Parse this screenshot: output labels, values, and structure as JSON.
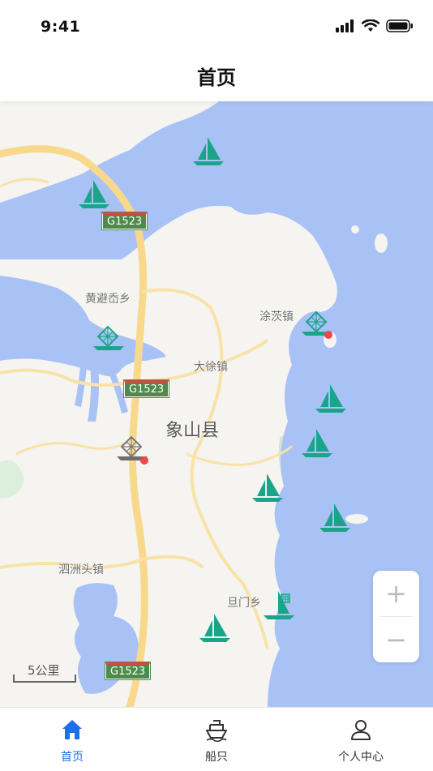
{
  "status_bar": {
    "time": "9:41"
  },
  "nav": {
    "title": "首页"
  },
  "map": {
    "place_labels": {
      "huangbi": "黄避岙乡",
      "tuci": "涂茨镇",
      "daxu": "大徐镇",
      "xiangshan": "象山县",
      "sizhoutou": "泗洲头镇",
      "danmen": "旦门乡"
    },
    "road_labels": {
      "g1523_top": "G1523",
      "g1523_mid": "G1523",
      "g1523_bottom": "G1523"
    },
    "scale": "5公里",
    "zoom": {
      "in": "+",
      "out": "−"
    },
    "colors": {
      "water": "#a9c2f5",
      "land": "#f5f4f1",
      "road": "#f8d98c",
      "marker": "#1aa58a",
      "alert": "#f2474a"
    }
  },
  "tabs": [
    {
      "label": "首页",
      "icon": "home-icon",
      "active": true
    },
    {
      "label": "船只",
      "icon": "ship-icon",
      "active": false
    },
    {
      "label": "个人中心",
      "icon": "user-icon",
      "active": false
    }
  ]
}
